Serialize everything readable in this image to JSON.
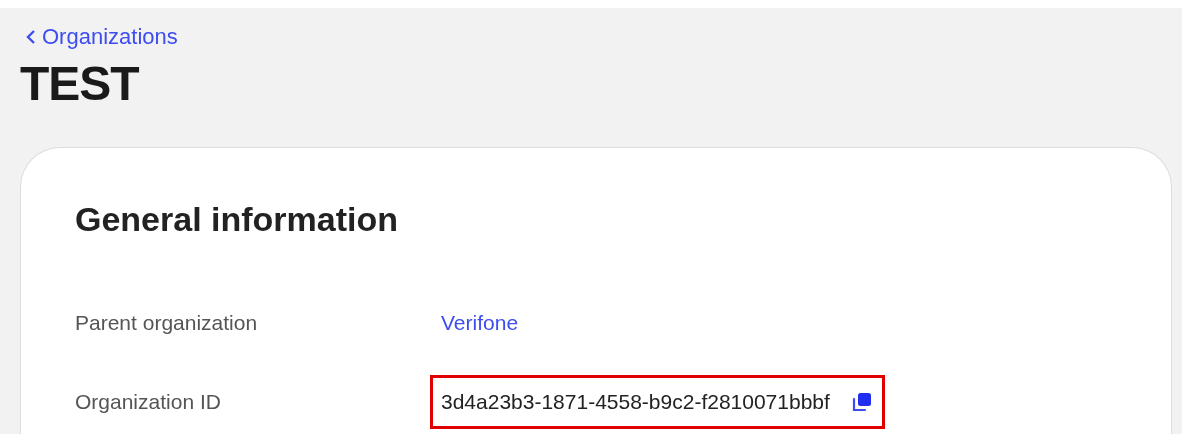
{
  "back_link": {
    "label": "Organizations"
  },
  "title": "TEST",
  "card": {
    "heading": "General information",
    "rows": [
      {
        "kind": "link",
        "label": "Parent organization",
        "value": "Verifone",
        "highlighted": false,
        "copyable": false
      },
      {
        "kind": "text",
        "label": "Organization ID",
        "value": "3d4a23b3-1871-4558-b9c2-f2810071bbbf",
        "highlighted": true,
        "copyable": true
      }
    ]
  }
}
